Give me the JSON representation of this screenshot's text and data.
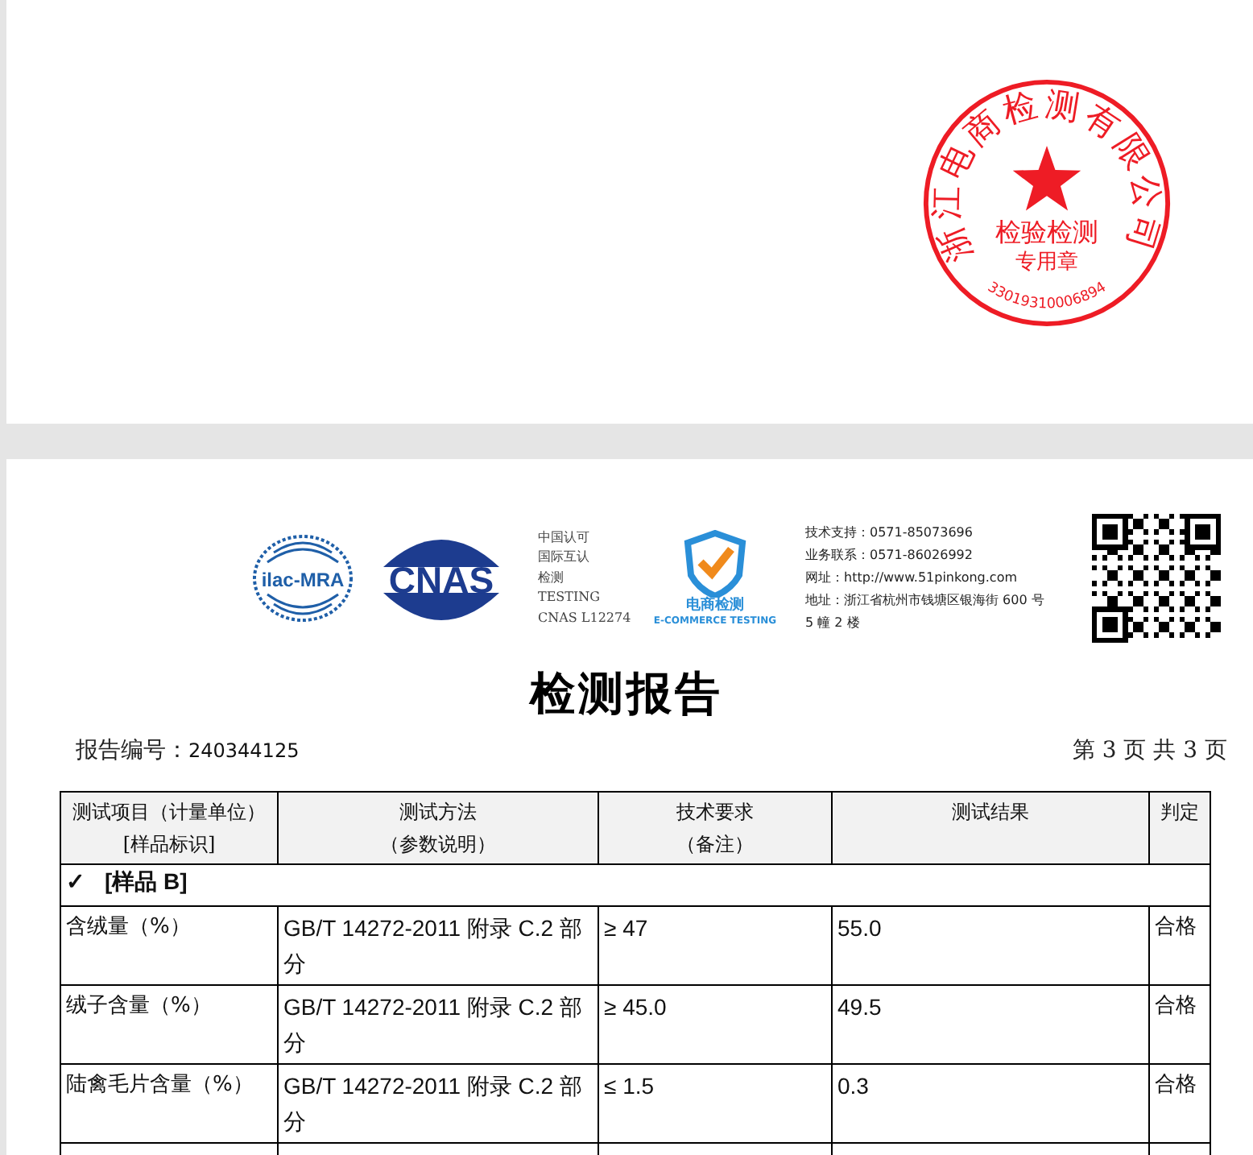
{
  "stamp": {
    "company": "浙江电商检测有限公司",
    "purpose": "检验检测",
    "usage": "专用章",
    "number": "33019310006894"
  },
  "letterhead": {
    "logos": [
      {
        "kind": "ilac",
        "text": "ilac-MRA"
      },
      {
        "kind": "cnas",
        "text": "CNAS"
      }
    ],
    "accreditation": [
      "中国认可",
      "国际互认",
      "检测",
      "TESTING",
      "CNAS L12274"
    ],
    "badge": {
      "title": "电商检测",
      "subtitle": "E-COMMERCE TESTING"
    },
    "contacts": [
      "技术支持：0571-85073696",
      "业务联系：0571-86026992",
      "网址：http://www.51pinkong.com",
      "地址：浙江省杭州市钱塘区银海街 600 号",
      "5 幢 2 楼"
    ]
  },
  "title": "检测报告",
  "report_number": {
    "label": "报告编号：",
    "value": "240344125"
  },
  "page_info": "第 3 页 共 3 页",
  "table": {
    "columns": [
      {
        "lines": [
          "测试项目（计量单位）",
          "[样品标识]"
        ]
      },
      {
        "lines": [
          "测试方法",
          "（参数说明）"
        ]
      },
      {
        "lines": [
          "技术要求",
          "（备注）"
        ]
      },
      {
        "lines": [
          "测试结果"
        ]
      },
      {
        "lines": [
          "判定"
        ]
      }
    ],
    "group": {
      "mark": "✓",
      "label": "[样品 B]"
    },
    "rows": [
      {
        "item": "含绒量（%）",
        "method": "GB/T 14272-2011  附录 C.2 部分",
        "requirement": "≥ 47",
        "result": "55.0",
        "verdict": "合格"
      },
      {
        "item": "绒子含量（%）",
        "method": "GB/T 14272-2011  附录 C.2 部分",
        "requirement": "≥ 45.0",
        "result": "49.5",
        "verdict": "合格"
      },
      {
        "item": "陆禽毛片含量（%）",
        "method": "GB/T 14272-2011  附录 C.2 部分",
        "requirement": "≤ 1.5",
        "result": "0.3",
        "verdict": "合格"
      }
    ]
  }
}
